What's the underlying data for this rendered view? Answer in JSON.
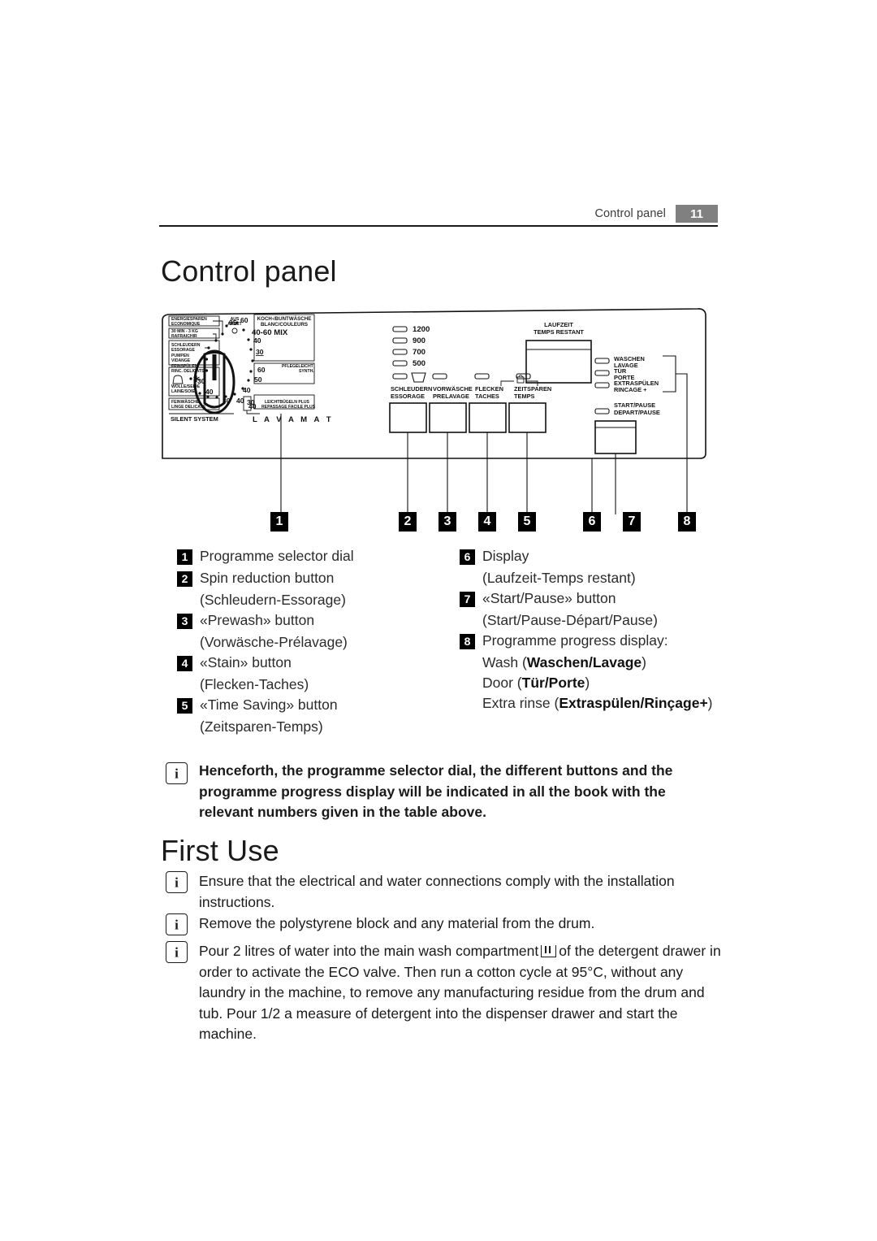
{
  "header": {
    "section_label": "Control panel",
    "page_number": "11",
    "page_box_color": "#808080"
  },
  "headings": {
    "control_panel": "Control panel",
    "first_use": "First Use"
  },
  "panel": {
    "brand": "LAVAMAT",
    "silent_system": "SILENT SYSTEM",
    "dial": {
      "off": {
        "de": "AUS",
        "fr": "ARRET"
      },
      "left_labels": [
        {
          "de": "ENERGIESPAREN",
          "fr": "ECONOMIQUE"
        },
        {
          "de": "30 MIN - 3 KG",
          "fr": "RAFRAICHIR"
        },
        {
          "de": "SCHLEUDERN",
          "fr": "ESSORAGE"
        },
        {
          "de": "PUMPEN",
          "fr": "VIDANGE"
        },
        {
          "de": "FEINSPÜLEN",
          "fr": "RINC. DELICATS"
        },
        {
          "de": "WOLLE/SEIDE",
          "fr": "LAINE/SOIE"
        },
        {
          "de": "FEINWÄSCHE",
          "fr": "LINGE DELICATS"
        }
      ],
      "right_labels": [
        {
          "de": "KOCH-/BUNTWÄSCHE",
          "fr": "BLANC/COULEURS"
        },
        {
          "de": "PFLEGELEICHT",
          "fr": "SYNTH."
        },
        {
          "de": "LEICHTBÜGELN  PLUS",
          "fr": "REPASSAGE FACILE PLUS"
        }
      ],
      "temperatures": [
        "95",
        "60",
        "40-60 MIX",
        "40",
        "30",
        "60",
        "50",
        "40",
        "30",
        "40",
        "40",
        "30",
        "40",
        "30"
      ],
      "cotton_scale": [
        "95",
        "60",
        "40-60 MIX",
        "40",
        "30"
      ],
      "synthetic_scale": [
        "60",
        "50",
        "40",
        "30"
      ],
      "delicates_scale": [
        "40",
        "30"
      ],
      "wool_scale": [
        "40",
        "30"
      ]
    },
    "spin_speeds": [
      "1200",
      "900",
      "700",
      "500"
    ],
    "buttons": [
      {
        "de": "SCHLEUDERN",
        "fr": "ESSORAGE"
      },
      {
        "de": "VORWÄSCHE",
        "fr": "PRELAVAGE"
      },
      {
        "de": "FLECKEN",
        "fr": "TACHES"
      },
      {
        "de": "ZEITSPAREN",
        "fr": "TEMPS"
      }
    ],
    "display_label": {
      "de": "LAUFZEIT",
      "fr": "TEMPS RESTANT"
    },
    "progress_lights": [
      {
        "de": "WASCHEN",
        "fr": "LAVAGE"
      },
      {
        "de": "TÜR",
        "fr": "PORTE"
      },
      {
        "de": "EXTRASPÜLEN",
        "fr": "RINCAGE +"
      }
    ],
    "start_pause": {
      "de": "START/PAUSE",
      "fr": "DEPART/PAUSE"
    },
    "callout_numbers": [
      "1",
      "2",
      "3",
      "4",
      "5",
      "6",
      "7",
      "8"
    ]
  },
  "legend": {
    "left": [
      {
        "num": "1",
        "text": "Programme selector dial",
        "sub": ""
      },
      {
        "num": "2",
        "text": "Spin reduction button",
        "sub": "(Schleudern-Essorage)"
      },
      {
        "num": "3",
        "text": "«Prewash» button",
        "sub": "(Vorwäsche-Prélavage)"
      },
      {
        "num": "4",
        "text": "«Stain» button",
        "sub": "(Flecken-Taches)"
      },
      {
        "num": "5",
        "text": "«Time Saving» button",
        "sub": "(Zeitsparen-Temps)"
      }
    ],
    "right": [
      {
        "num": "6",
        "text": "Display",
        "sub": "(Laufzeit-Temps restant)"
      },
      {
        "num": "7",
        "text": "«Start/Pause» button",
        "sub": "(Start/Pause-Départ/Pause)"
      },
      {
        "num": "8",
        "text": "Programme progress display:",
        "sub": ""
      }
    ],
    "progress_lines": [
      {
        "pre": "Wash (",
        "alt": "Waschen/Lavage",
        "post": ")"
      },
      {
        "pre": "Door (",
        "alt": "Tür/Porte",
        "post": ")"
      },
      {
        "pre": "Extra rinse (",
        "alt": "Extraspülen/Rinçage+",
        "post": ")"
      }
    ]
  },
  "notes": {
    "henceforth": "Henceforth, the programme selector dial, the different buttons and the programme progress display will be indicated in all the book with the relevant numbers given in the table above.",
    "ensure": "Ensure that the electrical and water connections comply with the installation instructions.",
    "remove": "Remove the polystyrene block and any material from the drum.",
    "pour_part1": "Pour 2 litres of water into the main wash compartment",
    "pour_part2": "of the detergent drawer in order to activate the ECO valve. Then run a cotton cycle at 95°C, without any laundry in the machine, to remove any manufacturing residue from the drum and tub. Pour 1/2 a measure of detergent into the dispenser drawer and start the machine."
  }
}
